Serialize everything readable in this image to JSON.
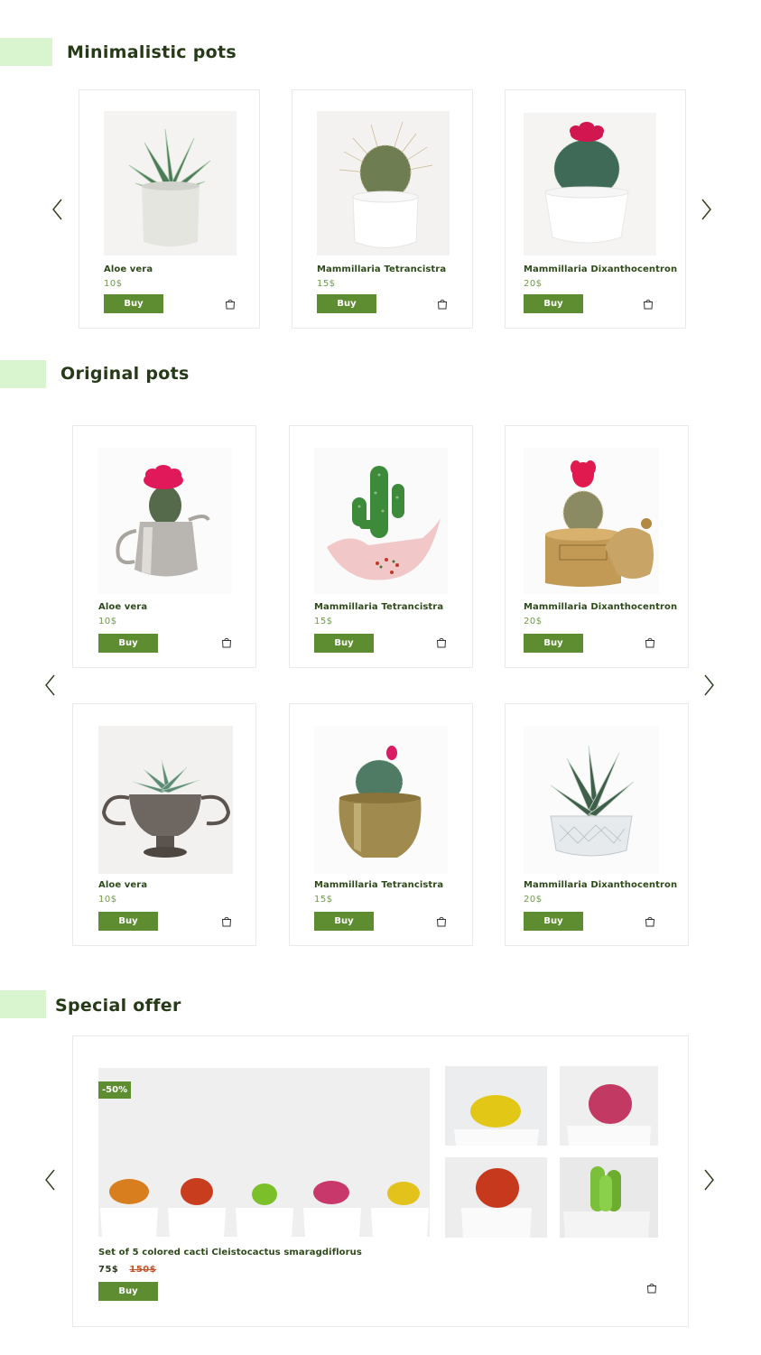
{
  "sections": {
    "minimalistic": {
      "title": "Minimalistic pots"
    },
    "original": {
      "title": "Original pots"
    },
    "special": {
      "title": "Special offer"
    }
  },
  "minimalistic_products": [
    {
      "name": "Aloe vera",
      "price": "10$",
      "buy_label": "Buy"
    },
    {
      "name": "Mammillaria Tetrancistra",
      "price": "15$",
      "buy_label": "Buy"
    },
    {
      "name": "Mammillaria Dixanthocentron",
      "price": "20$",
      "buy_label": "Buy"
    }
  ],
  "original_products": [
    {
      "name": "Aloe vera",
      "price": "10$",
      "buy_label": "Buy"
    },
    {
      "name": "Mammillaria Tetrancistra",
      "price": "15$",
      "buy_label": "Buy"
    },
    {
      "name": "Mammillaria Dixanthocentron",
      "price": "20$",
      "buy_label": "Buy"
    },
    {
      "name": "Aloe vera",
      "price": "10$",
      "buy_label": "Buy"
    },
    {
      "name": "Mammillaria Tetrancistra",
      "price": "15$",
      "buy_label": "Buy"
    },
    {
      "name": "Mammillaria Dixanthocentron",
      "price": "20$",
      "buy_label": "Buy"
    }
  ],
  "special_offer": {
    "badge": "-50%",
    "name": "Set of 5 colored cacti Cleistocactus smaragdiflorus",
    "price": "75$",
    "old_price": "150$",
    "buy_label": "Buy"
  },
  "icons": {
    "prev": "chevron-left-icon",
    "next": "chevron-right-icon",
    "cart": "shopping-bag-icon"
  },
  "colors": {
    "accent": "#5e8c31",
    "accent_light": "#d8f5cf",
    "title": "#263a17",
    "price": "#6f9a4a",
    "old_price": "#c4542c"
  }
}
